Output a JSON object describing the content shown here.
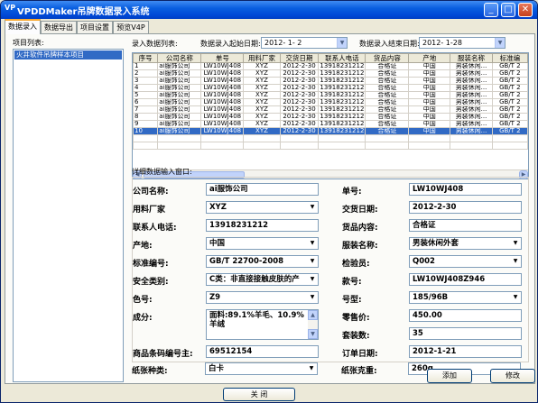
{
  "window": {
    "title": "VPDDMaker吊牌数据录入系统",
    "app_icon": "VP",
    "min_glyph": "_",
    "max_glyph": "□",
    "close_glyph": "✕"
  },
  "tabs": [
    "数据录入",
    "数据导出",
    "项目设置",
    "预览V4P"
  ],
  "left": {
    "label": "项目列表:",
    "items": [
      "火井软件吊牌样本项目"
    ]
  },
  "top": {
    "list_label": "录入数据列表:",
    "start_label": "数据录入起始日期:",
    "start_value": "2012- 1- 2",
    "end_label": "数据录入结束日期:",
    "end_value": "2012- 1-28"
  },
  "grid": {
    "columns": [
      "序号",
      "公司名称",
      "单号",
      "用料厂家",
      "交货日期",
      "联系人电话",
      "货品内容",
      "产地",
      "服装名称",
      "标准编"
    ],
    "rows": [
      [
        "1",
        "ai服饰公司",
        "LW10WJ408",
        "XYZ",
        "2012-2-30",
        "13918231212",
        "合格证",
        "中国",
        "男装休闲...",
        "GB/T 2"
      ],
      [
        "2",
        "ai服饰公司",
        "LW10WJ408",
        "XYZ",
        "2012-2-30",
        "13918231212",
        "合格证",
        "中国",
        "男装休闲...",
        "GB/T 2"
      ],
      [
        "3",
        "ai服饰公司",
        "LW10WJ408",
        "XYZ",
        "2012-2-30",
        "13918231212",
        "合格证",
        "中国",
        "男装休闲...",
        "GB/T 2"
      ],
      [
        "4",
        "ai服饰公司",
        "LW10WJ408",
        "XYZ",
        "2012-2-30",
        "13918231212",
        "合格证",
        "中国",
        "男装休闲...",
        "GB/T 2"
      ],
      [
        "5",
        "ai服饰公司",
        "LW10WJ408",
        "XYZ",
        "2012-2-30",
        "13918231212",
        "合格证",
        "中国",
        "男装休闲...",
        "GB/T 2"
      ],
      [
        "6",
        "ai服饰公司",
        "LW10WJ408",
        "XYZ",
        "2012-2-30",
        "13918231212",
        "合格证",
        "中国",
        "男装休闲...",
        "GB/T 2"
      ],
      [
        "7",
        "ai服饰公司",
        "LW10WJ408",
        "XYZ",
        "2012-2-30",
        "13918231212",
        "合格证",
        "中国",
        "男装休闲...",
        "GB/T 2"
      ],
      [
        "8",
        "ai服饰公司",
        "LW10WJ408",
        "XYZ",
        "2012-2-30",
        "13918231212",
        "合格证",
        "中国",
        "男装休闲...",
        "GB/T 2"
      ],
      [
        "9",
        "ai服饰公司",
        "LW10WJ408",
        "XYZ",
        "2012-2-30",
        "13918231212",
        "合格证",
        "中国",
        "男装休闲...",
        "GB/T 2"
      ],
      [
        "10",
        "ai服饰公司",
        "LW10WJ408",
        "XYZ",
        "2012-2-30",
        "13918231212",
        "合格证",
        "中国",
        "男装休闲...",
        "GB/T 2"
      ]
    ],
    "selected_row": 9
  },
  "detail": {
    "label": "详细数据输入窗口:",
    "company_label": "公司名称:",
    "company": "ai服饰公司",
    "order_label": "单号:",
    "order": "LW10WJ408",
    "maker_label": "用料厂家",
    "maker": "XYZ",
    "delivery_label": "交货日期:",
    "delivery": "2012-2-30",
    "phone_label": "联系人电话:",
    "phone": "13918231212",
    "content_label": "货品内容:",
    "content": "合格证",
    "origin_label": "产地:",
    "origin": "中国",
    "garment_label": "服装名称:",
    "garment": "男装休闲外套",
    "standard_label": "标准编号:",
    "standard": "GB/T 22700-2008",
    "inspector_label": "检验员:",
    "inspector": "Q002",
    "safety_label": "安全类别:",
    "safety": "C类：非直接接触皮肤的产",
    "style_label": "款号:",
    "style": "LW10WJ408Z946",
    "color_label": "色号:",
    "color": "Z9",
    "size_label": "号型:",
    "size": "185/96B",
    "composition_label": "成分:",
    "composition": "面料:89.1%羊毛、10.9%羊绒",
    "retail_label": "零售价:",
    "retail": "450.00",
    "sets_label": "套装数:",
    "sets": "35",
    "barcode_label": "商品条码编号主:",
    "barcode": "69512154",
    "orderdate_label": "订单日期:",
    "orderdate": "2012-1-21",
    "paper_label": "纸张种类:",
    "paper": "白卡",
    "weight_label": "纸张克重:",
    "weight": "260g"
  },
  "buttons": {
    "add": "添加",
    "edit": "修改",
    "close": "关    闭"
  }
}
